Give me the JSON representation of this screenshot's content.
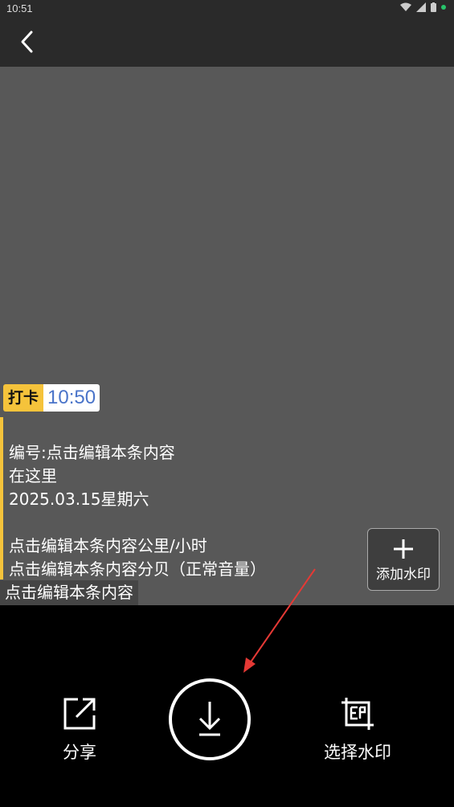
{
  "status_bar": {
    "time": "10:51"
  },
  "preview": {
    "badge_tag": "打卡",
    "badge_time": "10:50",
    "lines": [
      "编号:点击编辑本条内容",
      "在这里",
      "2025.03.15星期六",
      "点击编辑本条内容公里/小时",
      "点击编辑本条内容分贝（正常音量）"
    ],
    "footer": "点击编辑本条内容",
    "add_watermark_label": "添加水印"
  },
  "bottom": {
    "share_label": "分享",
    "select_watermark_label": "选择水印"
  },
  "colors": {
    "accent": "#f5c33b",
    "annotation_arrow": "#e53935"
  },
  "icons": [
    "back-icon",
    "wifi-icon",
    "signal-icon",
    "battery-icon",
    "plus-icon",
    "share-icon",
    "download-icon",
    "watermark-frame-icon"
  ]
}
